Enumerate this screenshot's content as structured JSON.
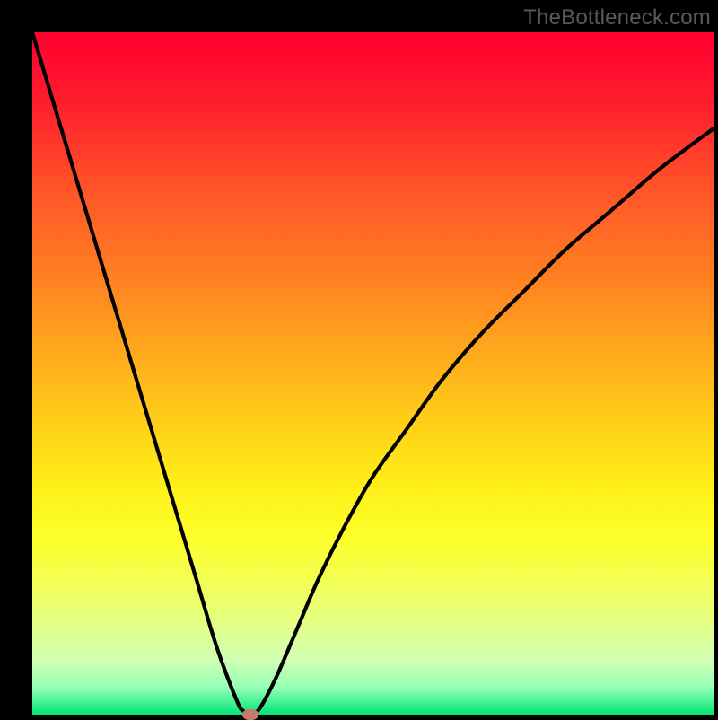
{
  "watermark": "TheBottleneck.com",
  "colors": {
    "frame": "#000000",
    "curve": "#000000",
    "marker": "#c77a6a",
    "gradient_top": "#ff0030",
    "gradient_bottom": "#00e676"
  },
  "chart_data": {
    "type": "line",
    "title": "",
    "xlabel": "",
    "ylabel": "",
    "xlim": [
      0,
      100
    ],
    "ylim": [
      0,
      100
    ],
    "grid": false,
    "legend": false,
    "annotations": [],
    "x": [
      0,
      3,
      6,
      9,
      12,
      15,
      18,
      21,
      24,
      27,
      30,
      31,
      32,
      33,
      34,
      36,
      39,
      42,
      46,
      50,
      55,
      60,
      66,
      72,
      78,
      85,
      92,
      100
    ],
    "y": [
      100,
      90,
      80,
      70,
      60,
      50,
      40,
      30,
      20,
      10,
      2,
      0.5,
      0,
      0.5,
      2,
      6,
      13,
      20,
      28,
      35,
      42,
      49,
      56,
      62,
      68,
      74,
      80,
      86
    ],
    "marker": {
      "x": 32,
      "y": 0
    },
    "gradient_stops": [
      {
        "pos": 0.0,
        "color": "#ff0030"
      },
      {
        "pos": 0.22,
        "color": "#ff5028"
      },
      {
        "pos": 0.48,
        "color": "#ffad1c"
      },
      {
        "pos": 0.66,
        "color": "#ffee18"
      },
      {
        "pos": 0.86,
        "color": "#e6ff80"
      },
      {
        "pos": 1.0,
        "color": "#00e676"
      }
    ]
  }
}
